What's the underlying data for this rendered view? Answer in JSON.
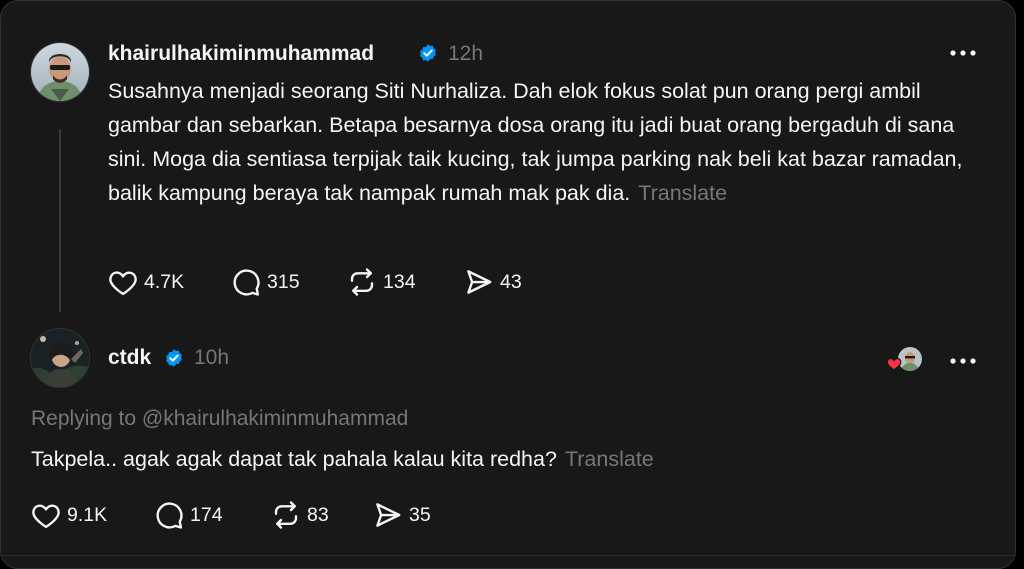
{
  "post": {
    "username": "khairulhakiminmuhammad",
    "time": "12h",
    "text": "Susahnya menjadi seorang Siti Nurhaliza. Dah elok fokus solat pun orang pergi ambil gambar dan sebarkan. Betapa besarnya dosa orang itu jadi buat orang bergaduh di sana sini. Moga dia sentiasa terpijak taik kucing, tak jumpa parking nak beli kat bazar ramadan, balik kampung beraya tak nampak rumah mak pak dia.",
    "translate": "Translate",
    "likes": "4.7K",
    "replies": "315",
    "reposts": "134",
    "shares": "43"
  },
  "reply": {
    "username": "ctdk",
    "time": "10h",
    "replying_to": "Replying to @khairulhakiminmuhammad",
    "text": "Takpela.. agak agak dapat tak pahala kalau kita redha?",
    "translate": "Translate",
    "likes": "9.1K",
    "replies": "174",
    "reposts": "83",
    "shares": "35"
  },
  "icons": {
    "verified": "verified-badge-icon",
    "like": "heart-icon",
    "reply": "comment-icon",
    "repost": "repost-icon",
    "share": "share-icon",
    "more": "more-icon"
  },
  "colors": {
    "background": "#181818",
    "text": "#f3f5f7",
    "muted": "#777777",
    "verified": "#0095f6",
    "liked_heart": "#ff3040"
  }
}
